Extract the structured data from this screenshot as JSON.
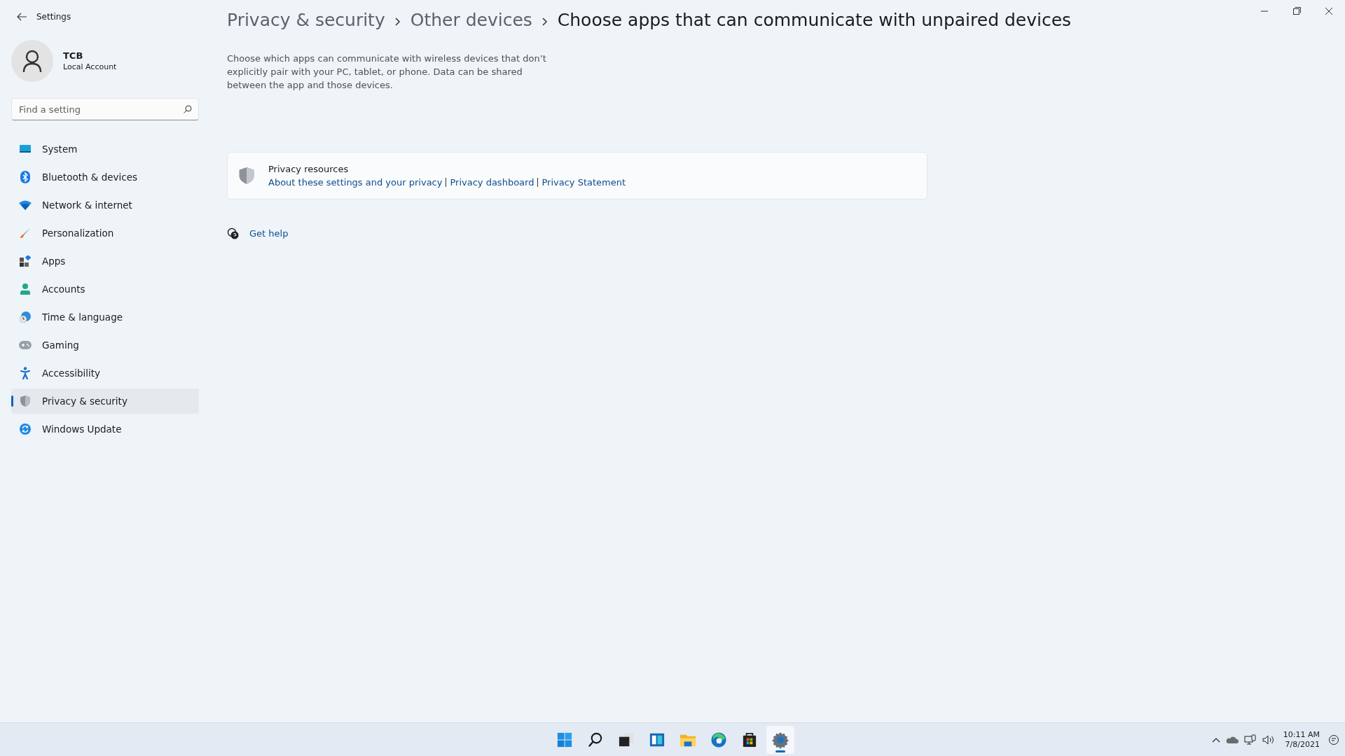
{
  "window": {
    "title": "Settings"
  },
  "account": {
    "name": "TCB",
    "type": "Local Account"
  },
  "search": {
    "placeholder": "Find a setting"
  },
  "nav": [
    {
      "label": "System",
      "selected": false
    },
    {
      "label": "Bluetooth & devices",
      "selected": false
    },
    {
      "label": "Network & internet",
      "selected": false
    },
    {
      "label": "Personalization",
      "selected": false
    },
    {
      "label": "Apps",
      "selected": false
    },
    {
      "label": "Accounts",
      "selected": false
    },
    {
      "label": "Time & language",
      "selected": false
    },
    {
      "label": "Gaming",
      "selected": false
    },
    {
      "label": "Accessibility",
      "selected": false
    },
    {
      "label": "Privacy & security",
      "selected": true
    },
    {
      "label": "Windows Update",
      "selected": false
    }
  ],
  "breadcrumb": [
    "Privacy & security",
    "Other devices",
    "Choose apps that can communicate with unpaired devices"
  ],
  "description": "Choose which apps can communicate with wireless devices that don’t explicitly pair with your PC, tablet, or phone. Data can be shared between the app and those devices.",
  "privacy_resources": {
    "title": "Privacy resources",
    "links": [
      "About these settings and your privacy",
      "Privacy dashboard",
      "Privacy Statement"
    ]
  },
  "help": {
    "label": "Get help"
  },
  "taskbar": {
    "apps": [
      {
        "kind": "start",
        "selected": false
      },
      {
        "kind": "search",
        "selected": false
      },
      {
        "kind": "taskview",
        "selected": false
      },
      {
        "kind": "widgets",
        "selected": false
      },
      {
        "kind": "explorer",
        "selected": false
      },
      {
        "kind": "browser",
        "selected": false
      },
      {
        "kind": "store",
        "selected": false
      },
      {
        "kind": "settings",
        "selected": true
      }
    ],
    "time": "10:11 AM",
    "date": "7/8/2021"
  }
}
